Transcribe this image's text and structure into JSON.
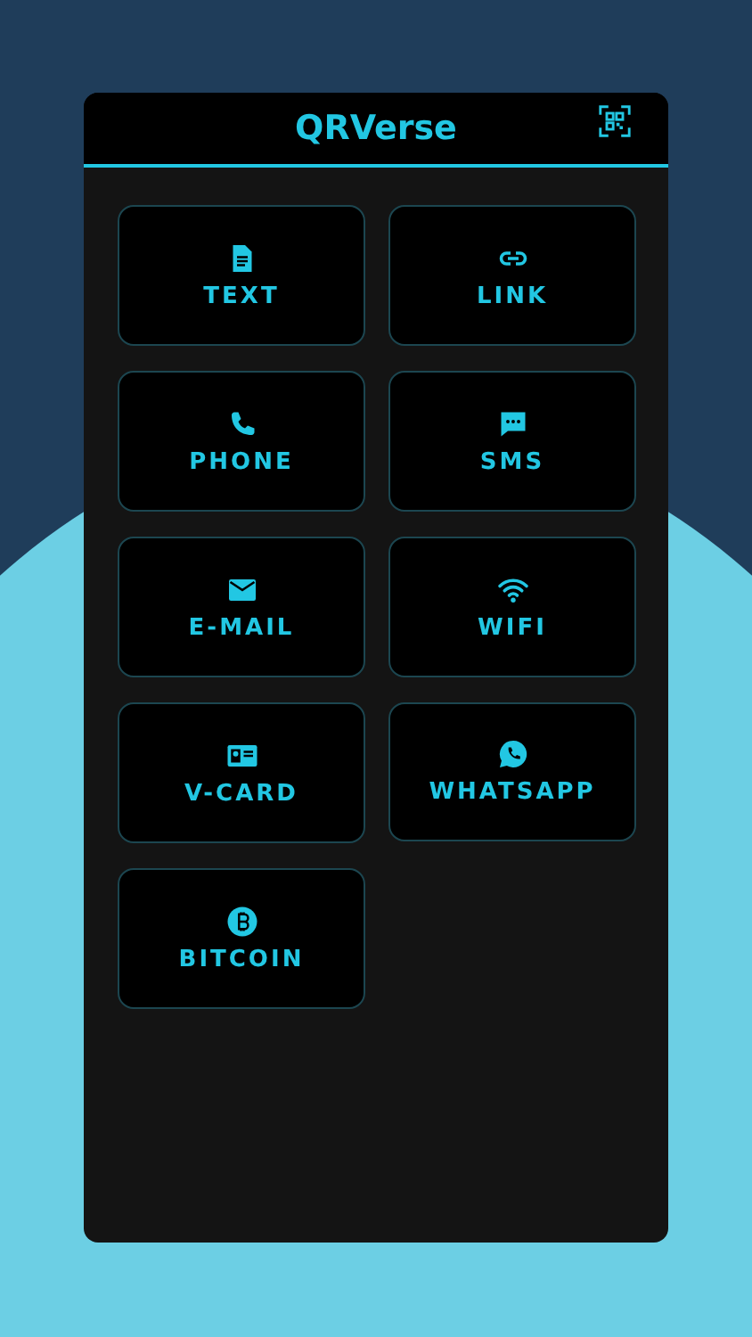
{
  "app_bar": {
    "title": "QRVerse"
  },
  "tiles": [
    {
      "kind": "text",
      "label": "TEXT"
    },
    {
      "kind": "link",
      "label": "LINK"
    },
    {
      "kind": "phone",
      "label": "PHONE"
    },
    {
      "kind": "sms",
      "label": "SMS"
    },
    {
      "kind": "email",
      "label": "E-MAIL"
    },
    {
      "kind": "wifi",
      "label": "WIFI"
    },
    {
      "kind": "vcard",
      "label": "V-CARD"
    },
    {
      "kind": "whatsapp",
      "label": "WHATSAPP"
    },
    {
      "kind": "bitcoin",
      "label": "BITCOIN"
    }
  ]
}
